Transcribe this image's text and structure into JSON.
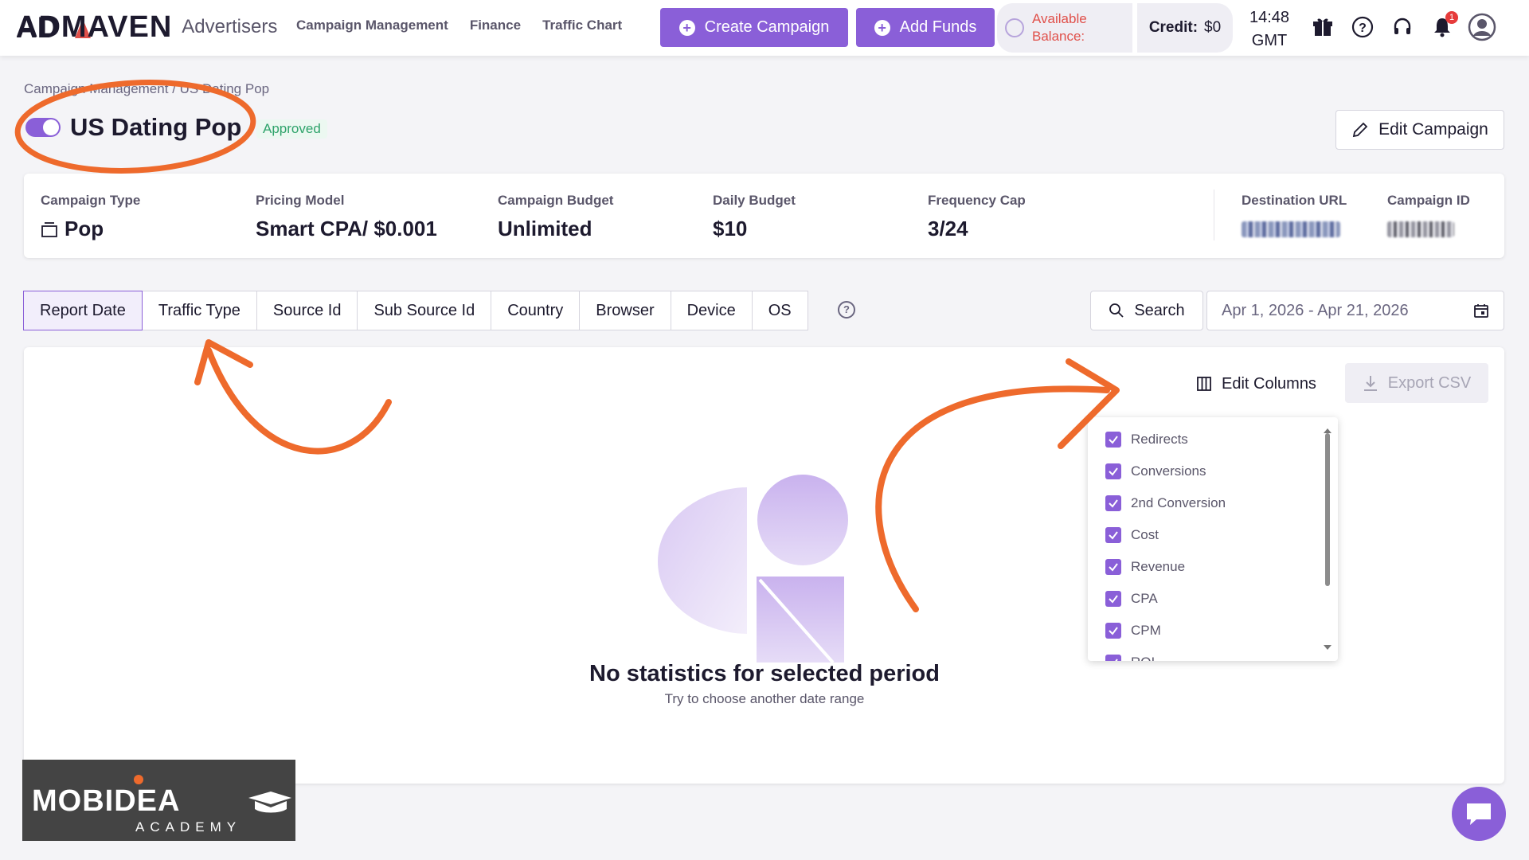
{
  "header": {
    "logo_text": "ADMAVEN",
    "logo_sub": "Advertisers",
    "nav": [
      "Campaign Management",
      "Finance",
      "Traffic Chart"
    ],
    "create_campaign": "Create Campaign",
    "add_funds": "Add Funds",
    "available_balance_label_1": "Available",
    "available_balance_label_2": "Balance:",
    "credit_label": "Credit:",
    "credit_value": "$0",
    "time": "14:48",
    "timezone": "GMT",
    "notification_count": "1"
  },
  "breadcrumb": {
    "parent": "Campaign Management",
    "separator": "/",
    "current": "US Dating Pop"
  },
  "campaign": {
    "title": "US Dating Pop",
    "status": "Approved",
    "edit_label": "Edit Campaign"
  },
  "info": {
    "type_label": "Campaign Type",
    "type_value": "Pop",
    "pricing_label": "Pricing Model",
    "pricing_value": "Smart CPA/ $0.001",
    "budget_label": "Campaign Budget",
    "budget_value": "Unlimited",
    "daily_label": "Daily Budget",
    "daily_value": "$10",
    "freq_label": "Frequency Cap",
    "freq_value": "3/24",
    "dest_label": "Destination URL",
    "id_label": "Campaign ID"
  },
  "tabs": [
    "Report Date",
    "Traffic Type",
    "Source Id",
    "Sub Source Id",
    "Country",
    "Browser",
    "Device",
    "OS"
  ],
  "filters": {
    "search_label": "Search",
    "date_range": "Apr 1, 2026 - Apr 21, 2026"
  },
  "report": {
    "edit_columns": "Edit Columns",
    "export_csv": "Export CSV",
    "columns": [
      "Redirects",
      "Conversions",
      "2nd Conversion",
      "Cost",
      "Revenue",
      "CPA",
      "CPM",
      "ROI"
    ],
    "empty_title": "No statistics for selected period",
    "empty_subtitle": "Try to choose another date range"
  },
  "watermark": {
    "brand": "MOBIDEA",
    "sub": "ACADEMY"
  },
  "colors": {
    "accent": "#8a5fd8",
    "annotation": "#ee6a2c",
    "approved": "#2fa36b",
    "balance_warning": "#e0504a"
  }
}
